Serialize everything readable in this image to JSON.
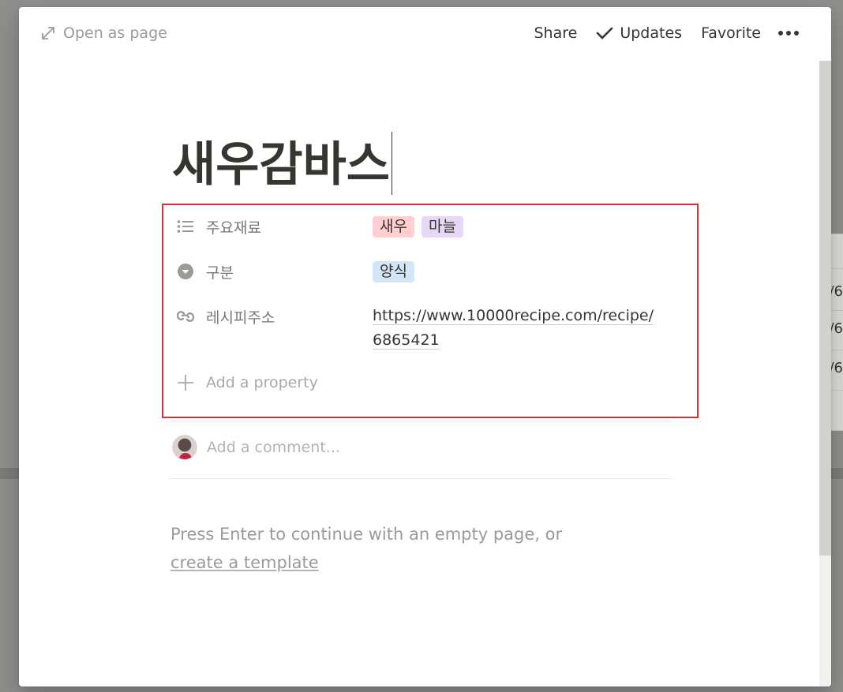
{
  "topbar": {
    "open_as_page": "Open as page",
    "share": "Share",
    "updates": "Updates",
    "favorite": "Favorite",
    "icons": {
      "open": "expand-arrows-icon",
      "updates": "checkmark-icon",
      "more": "more-dots-icon"
    }
  },
  "page": {
    "title": "새우감바스"
  },
  "properties": [
    {
      "icon": "list-icon",
      "label": "주요재료",
      "tags": [
        {
          "text": "새우",
          "color": "#ffcfd1"
        },
        {
          "text": "마늘",
          "color": "#e6d8f6"
        }
      ]
    },
    {
      "icon": "select-icon",
      "label": "구분",
      "tags": [
        {
          "text": "양식",
          "color": "#d3e5f7"
        }
      ]
    },
    {
      "icon": "link-icon",
      "label": "레시피주소",
      "url": "https://www.10000recipe.com/recipe/6865421"
    }
  ],
  "add_property": "Add a property",
  "comment": {
    "placeholder": "Add a comment..."
  },
  "empty_hint": {
    "text": "Press Enter to continue with an empty page, or",
    "link": "create a template"
  },
  "background": {
    "fragments": [
      "/6",
      "/6",
      "/6"
    ]
  },
  "colors": {
    "text": "#37352f",
    "muted": "#9b9a97",
    "highlight_box": "#d6303a"
  }
}
